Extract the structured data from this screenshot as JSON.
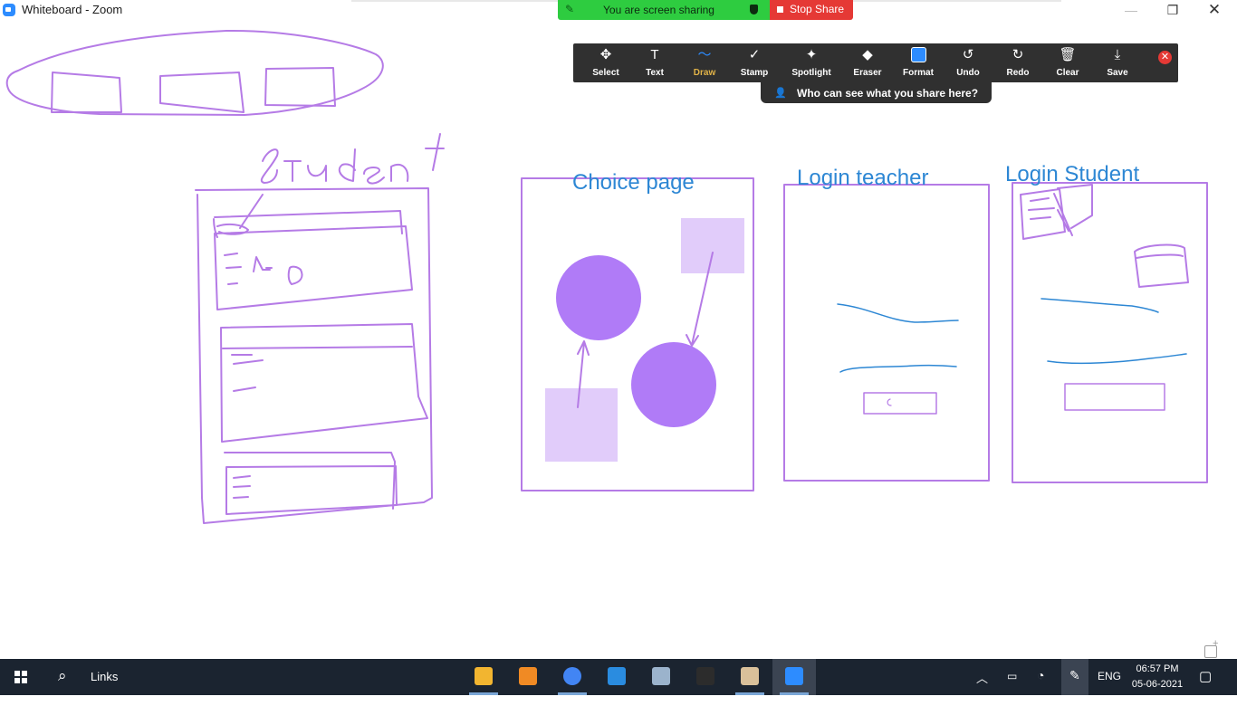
{
  "window": {
    "title": "Whiteboard - Zoom",
    "controls": {
      "minimize": "—",
      "restore": "❐",
      "close": "✕"
    }
  },
  "share_banner": {
    "status": "You are screen sharing",
    "stop_label": "Stop Share",
    "colors": {
      "status_bg": "#2ECC40",
      "stop_bg": "#E53935"
    }
  },
  "toolbar": {
    "tools": [
      {
        "label": "Select",
        "icon": "move-icon",
        "glyph": "✥"
      },
      {
        "label": "Text",
        "icon": "text-icon",
        "glyph": "T"
      },
      {
        "label": "Draw",
        "icon": "draw-icon",
        "glyph": "〜",
        "active": true
      },
      {
        "label": "Stamp",
        "icon": "check-icon",
        "glyph": "✓"
      },
      {
        "label": "Spotlight",
        "icon": "wand-icon",
        "glyph": "✦"
      },
      {
        "label": "Eraser",
        "icon": "eraser-icon",
        "glyph": "◆"
      },
      {
        "label": "Format",
        "icon": "format-icon",
        "glyph": ""
      },
      {
        "label": "Undo",
        "icon": "undo-icon",
        "glyph": "↺"
      },
      {
        "label": "Redo",
        "icon": "redo-icon",
        "glyph": "↻"
      },
      {
        "label": "Clear",
        "icon": "trash-icon",
        "glyph": "🗑"
      },
      {
        "label": "Save",
        "icon": "save-icon",
        "glyph": "⤓"
      }
    ],
    "who_can_see": "Who can see what you share here?",
    "accent": "#2D8CFF",
    "active_label_color": "#E1B348"
  },
  "whiteboard": {
    "labels": {
      "student": "Student",
      "choice_page": "Choice page",
      "login_teacher": "Login teacher",
      "login_student": "Login Student"
    },
    "colors": {
      "ink_purple": "#B57BE6",
      "fill_purple": "#B07BF7",
      "fill_lavender": "#E1CCFA",
      "ink_blue": "#2D87D4"
    }
  },
  "taskbar": {
    "search_label": "Links",
    "apps": [
      {
        "name": "file-explorer",
        "color": "#F2B530"
      },
      {
        "name": "sublime-text",
        "color": "#F08A24"
      },
      {
        "name": "chrome",
        "color": "#4285F4"
      },
      {
        "name": "vs-code",
        "color": "#2A8CE0"
      },
      {
        "name": "control-panel",
        "color": "#9bb3cc"
      },
      {
        "name": "terminal",
        "color": "#2c2c2c"
      },
      {
        "name": "paint",
        "color": "#d9c09a"
      },
      {
        "name": "zoom",
        "color": "#2D8CFF"
      }
    ],
    "language": "ENG",
    "time": "06:57 PM",
    "date": "05-06-2021"
  }
}
